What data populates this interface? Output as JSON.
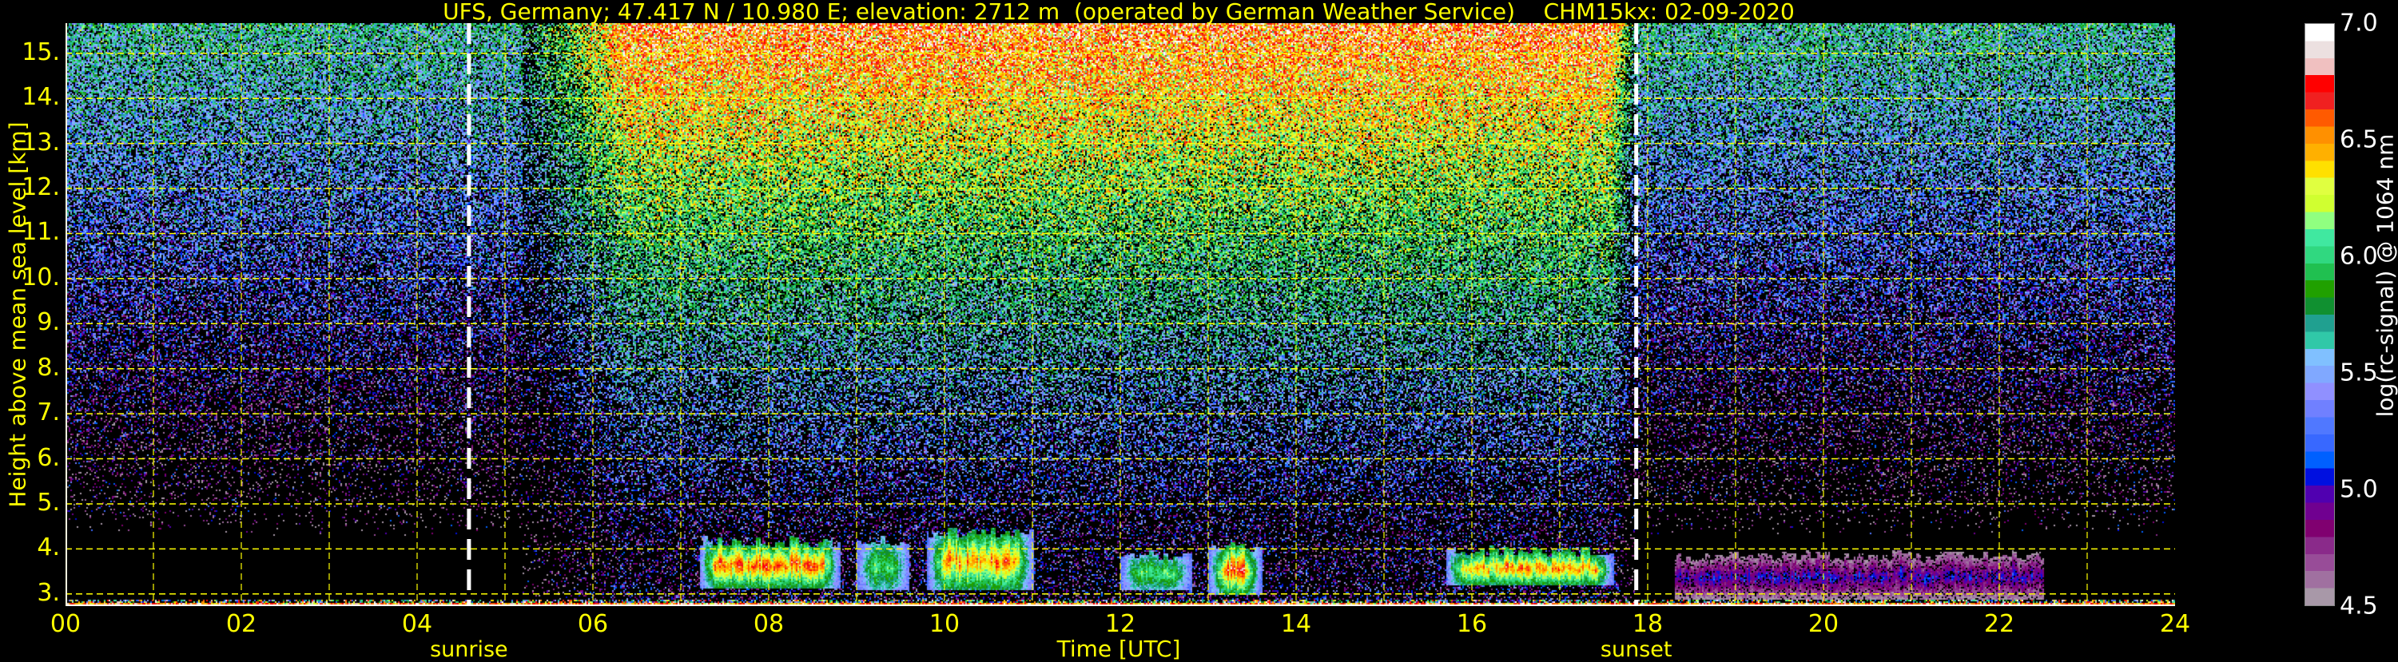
{
  "chart_data": {
    "type": "heatmap",
    "title": "UFS, Germany; 47.417 N / 10.980 E; elevation: 2712 m  (operated by German Weather Service)    CHM15kx: 02-09-2020",
    "xlabel": "Time [UTC]",
    "ylabel": "Height above mean sea level [km]",
    "xlim": [
      0,
      24
    ],
    "ylim": [
      2.73,
      15.67
    ],
    "x_ticks": [
      "00",
      "02",
      "04",
      "06",
      "08",
      "10",
      "12",
      "14",
      "16",
      "18",
      "20",
      "22",
      "24"
    ],
    "x_tick_values": [
      0,
      2,
      4,
      6,
      8,
      10,
      12,
      14,
      16,
      18,
      20,
      22,
      24
    ],
    "y_ticks": [
      "3.",
      "4.",
      "5.",
      "6.",
      "7.",
      "8.",
      "9.",
      "10.",
      "11.",
      "12.",
      "13.",
      "14.",
      "15."
    ],
    "y_tick_values": [
      3,
      4,
      5,
      6,
      7,
      8,
      9,
      10,
      11,
      12,
      13,
      14,
      15
    ],
    "grid": true,
    "events": [
      {
        "label": "sunrise",
        "time": 4.59
      },
      {
        "label": "sunset",
        "time": 17.87
      }
    ],
    "colorbar": {
      "label": "log(rc-signal) @ 1064 nm",
      "range": [
        4.5,
        7.0
      ],
      "ticks": [
        "4.5",
        "5.0",
        "5.5",
        "6.0",
        "6.5",
        "7.0"
      ],
      "tick_values": [
        4.5,
        5.0,
        5.5,
        6.0,
        6.5,
        7.0
      ],
      "colors": [
        "#a898a8",
        "#a070a0",
        "#984c98",
        "#8a2a8a",
        "#800070",
        "#700090",
        "#5000b0",
        "#0010e0",
        "#0060ff",
        "#3868ff",
        "#5078ff",
        "#7080ff",
        "#9090ff",
        "#80a8ff",
        "#80c0ff",
        "#30c8a8",
        "#20a090",
        "#109030",
        "#20a000",
        "#20c050",
        "#30d880",
        "#40e8a0",
        "#90ff80",
        "#d0ff30",
        "#e0ff40",
        "#ffe000",
        "#ffb000",
        "#ff9000",
        "#ff5a00",
        "#f02020",
        "#ff0000",
        "#f0c0c0",
        "#ece0e0",
        "#ffffff"
      ]
    },
    "features": [
      {
        "kind": "boundary-layer aerosol",
        "start": 7.2,
        "end": 8.8,
        "base_km": 3.15,
        "top_km": 4.3,
        "peak_log_signal": 6.8
      },
      {
        "kind": "boundary-layer aerosol",
        "start": 9.0,
        "end": 9.6,
        "base_km": 3.1,
        "top_km": 4.3,
        "peak_log_signal": 6.2
      },
      {
        "kind": "boundary-layer aerosol",
        "start": 9.8,
        "end": 11.0,
        "base_km": 3.1,
        "top_km": 4.5,
        "peak_log_signal": 6.7
      },
      {
        "kind": "boundary-layer aerosol",
        "start": 12.0,
        "end": 12.8,
        "base_km": 3.1,
        "top_km": 4.0,
        "peak_log_signal": 6.2
      },
      {
        "kind": "boundary-layer aerosol",
        "start": 13.0,
        "end": 13.6,
        "base_km": 3.0,
        "top_km": 4.2,
        "peak_log_signal": 6.9
      },
      {
        "kind": "boundary-layer aerosol",
        "start": 15.7,
        "end": 17.6,
        "base_km": 3.2,
        "top_km": 4.1,
        "peak_log_signal": 6.7
      },
      {
        "kind": "residual layer",
        "start": 18.3,
        "end": 22.5,
        "base_km": 2.9,
        "top_km": 4.0,
        "peak_log_signal": 4.9
      }
    ]
  }
}
